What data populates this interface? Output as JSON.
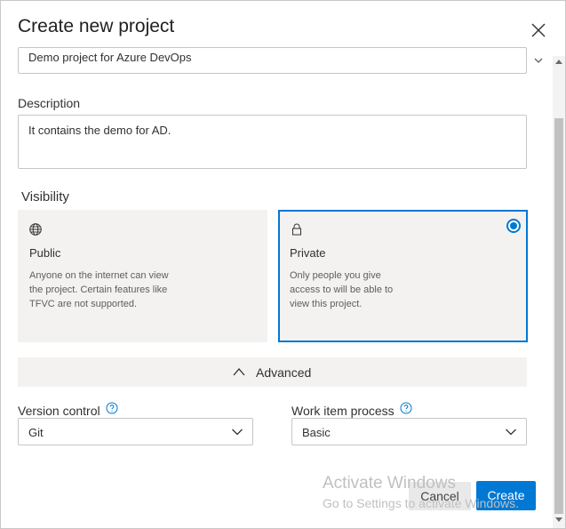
{
  "dialog": {
    "title": "Create new project",
    "close_icon": "close-icon"
  },
  "project_name": {
    "value": "Demo project for Azure DevOps"
  },
  "description": {
    "label": "Description",
    "value": "It contains the demo for AD."
  },
  "visibility": {
    "label": "Visibility",
    "selected": "Private",
    "options": [
      {
        "title": "Public",
        "icon": "globe-icon",
        "description": "Anyone on the internet can view the project. Certain features like TFVC are not supported."
      },
      {
        "title": "Private",
        "icon": "lock-icon",
        "description": "Only people you give access to will be able to view this project."
      }
    ]
  },
  "advanced": {
    "label": "Advanced",
    "icon": "chevron-up-icon"
  },
  "version_control": {
    "label": "Version control",
    "value": "Git"
  },
  "work_item_process": {
    "label": "Work item process",
    "value": "Basic"
  },
  "watermark": {
    "line1": "Activate Windows",
    "line2": "Go to Settings to activate Windows."
  },
  "buttons": {
    "cancel": "Cancel",
    "create": "Create"
  },
  "colors": {
    "accent": "#0078d4",
    "card_bg": "#f3f2f1",
    "border": "#c8c6c4"
  }
}
